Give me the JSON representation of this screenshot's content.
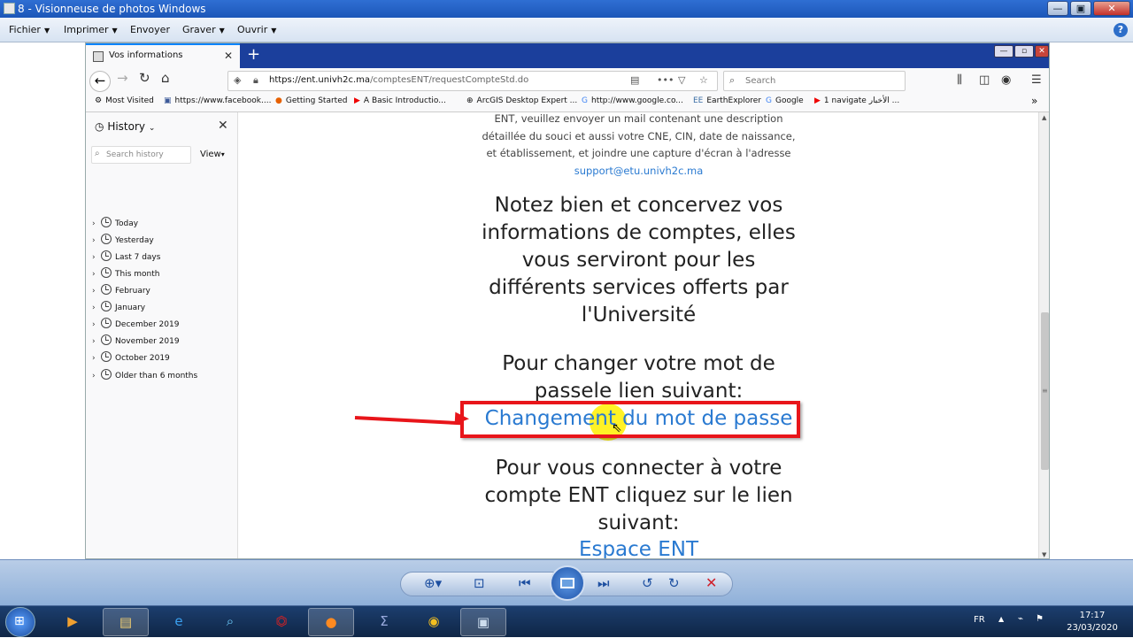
{
  "window": {
    "title": "8 - Visionneuse de photos Windows",
    "menu": [
      "Fichier",
      "Imprimer",
      "Envoyer",
      "Graver",
      "Ouvrir"
    ]
  },
  "browser": {
    "tab_title": "Vos informations",
    "url_host": "https://ent.univh2c.ma",
    "url_path": "/comptesENT/requestCompteStd.do",
    "search_placeholder": "Search",
    "bookmarks": [
      "Most Visited",
      "https://www.facebook....",
      "Getting Started",
      "A Basic Introductio...",
      "ArcGIS Desktop Expert ...",
      "http://www.google.co...",
      "EarthExplorer",
      "Google",
      "1 navigate الأخبار ..."
    ]
  },
  "sidebar": {
    "title": "History",
    "search_placeholder": "Search history",
    "view_label": "View",
    "items": [
      "Today",
      "Yesterday",
      "Last 7 days",
      "This month",
      "February",
      "January",
      "December 2019",
      "November 2019",
      "October 2019",
      "Older than 6 months"
    ]
  },
  "page": {
    "help_line1": "ENT, veuillez envoyer un mail contenant une description",
    "help_line2": "détaillée du souci et aussi votre CNE, CIN, date de naissance,",
    "help_line3": "et établissement, et joindre une capture d'écran à l'adresse",
    "support_email": "support@etu.univh2c.ma",
    "notice_line1": "Notez bien et concervez vos",
    "notice_line2": "informations de comptes, elles",
    "notice_line3": "vous serviront pour les",
    "notice_line4": "différents services offerts par",
    "notice_line5": "l'Université",
    "change_line1": "Pour changer votre mot de",
    "change_line2": "passele lien suivant:",
    "change_link": "Changement du mot de passe",
    "connect_line1": "Pour vous connecter à votre",
    "connect_line2": "compte ENT cliquez sur le lien",
    "connect_line3": "suivant:",
    "ent_link": "Espace ENT"
  },
  "taskbar": {
    "lang": "FR",
    "time": "17:17",
    "date": "23/03/2020"
  },
  "colors": {
    "link": "#2a7ad1",
    "annotation_red": "#e8151a",
    "highlight_yellow": "#fff000"
  }
}
